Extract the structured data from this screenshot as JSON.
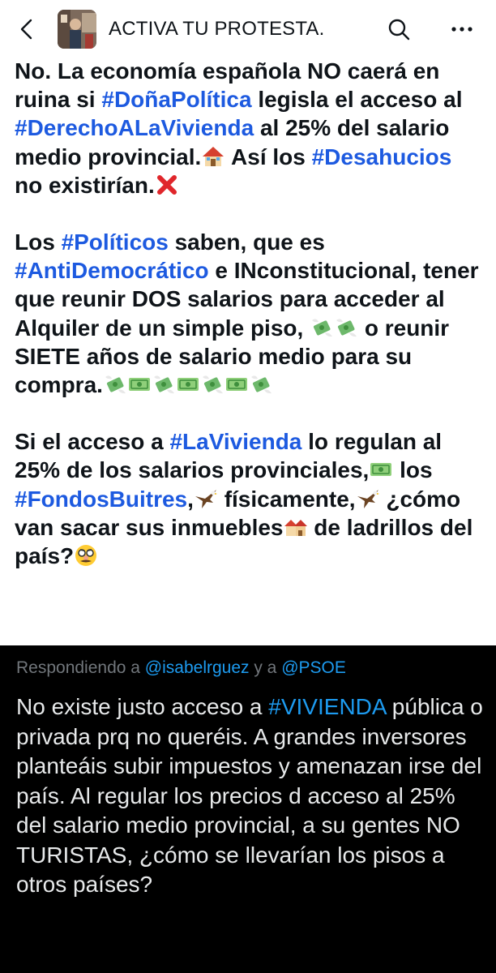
{
  "header": {
    "title": "ACTIVA TU PROTESTA.",
    "back_icon": "chevron-left-icon",
    "search_icon": "search-icon",
    "more_icon": "more-horizontal-icon"
  },
  "post": {
    "paragraph1": {
      "t1": "No. La economía española NO caerá en ruina si ",
      "h1": "#DoñaPolítica",
      "t2": " legisla el acceso al ",
      "h2": "#DerechoALaVivienda",
      "t3": " al 25% del salario medio provincial.",
      "t4": " Así los ",
      "h3": "#Desahucios",
      "t5": " no existirían."
    },
    "paragraph2": {
      "t1": "Los ",
      "h1": "#Políticos",
      "t2": " saben, que es ",
      "h2": "#AntiDemocrático",
      "t3": " e INconstitucional, tener que reunir DOS salarios para acceder al Alquiler de un simple piso, ",
      "t4": " o reunir SIETE años de salario medio para su compra."
    },
    "paragraph3": {
      "t1": "Si el acceso a ",
      "h1": "#LaVivienda",
      "t2": " lo regulan al 25% de los salarios provinciales,",
      "t3": " los ",
      "h2": "#FondosBuitres",
      "t4": ",",
      "t5": " físicamente,",
      "t6": " ¿cómo van sacar sus inmuebles",
      "t7": " de ladrillos del país?"
    }
  },
  "reply": {
    "replying_prefix": "Respondiendo a ",
    "handle1": "@isabelrguez",
    "conjunction": " y a ",
    "handle2": "@PSOE",
    "t1": "No existe justo acceso a ",
    "h1": "#VIVIENDA",
    "t2": " pública o privada prq no queréis. A grandes inversores planteáis subir impuestos y amenazan irse del país. Al regular los precios d acceso al 25% del salario medio provincial, a su gentes NO TURISTAS, ¿cómo se llevarían los pisos a otros países?"
  },
  "colors": {
    "hashtag_light": "#1d5ae0",
    "hashtag_dark": "#1d9bf0",
    "reply_background": "#000000"
  }
}
